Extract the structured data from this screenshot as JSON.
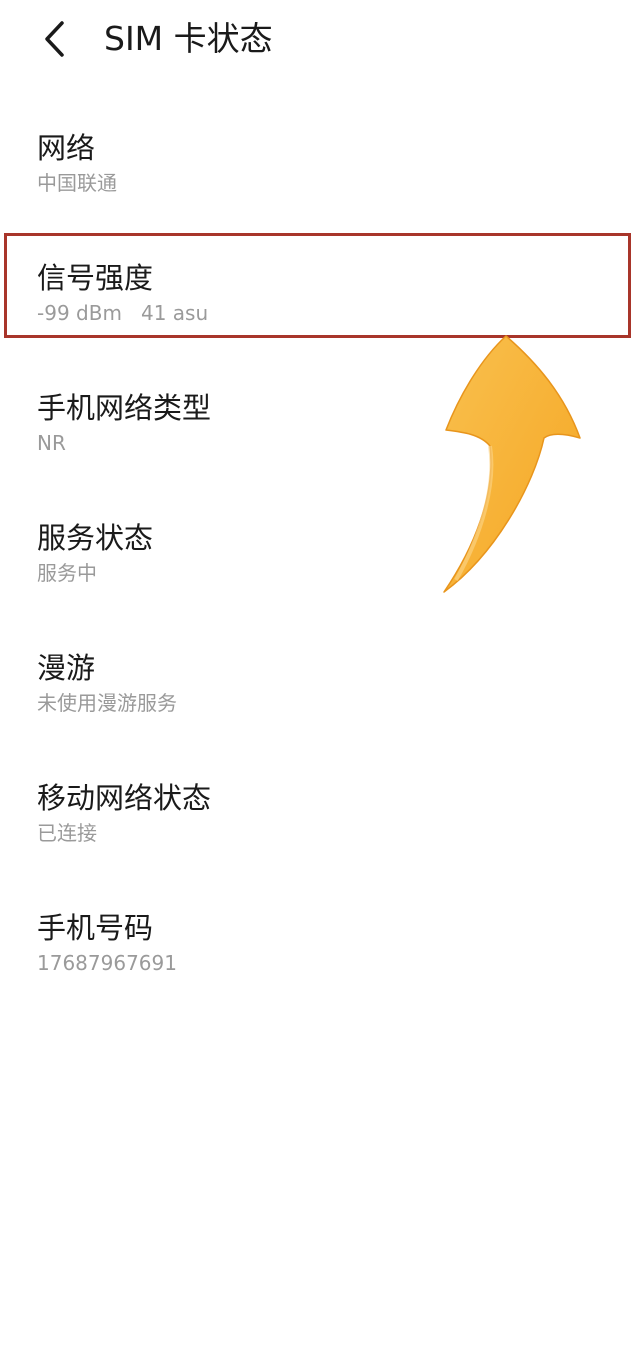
{
  "header": {
    "back_icon": "chevron-left-icon",
    "title": "SIM 卡状态"
  },
  "items": [
    {
      "title": "网络",
      "value": "中国联通"
    },
    {
      "title": "信号强度",
      "value": "-99 dBm   41 asu"
    },
    {
      "title": "手机网络类型",
      "value": "NR"
    },
    {
      "title": "服务状态",
      "value": "服务中"
    },
    {
      "title": "漫游",
      "value": "未使用漫游服务"
    },
    {
      "title": "移动网络状态",
      "value": "已连接"
    },
    {
      "title": "手机号码",
      "value": "17687967691"
    }
  ],
  "annotation": {
    "highlight_color": "#a8352a",
    "arrow_color": "#f7b13c",
    "arrow_icon": "curved-arrow-up-icon"
  }
}
